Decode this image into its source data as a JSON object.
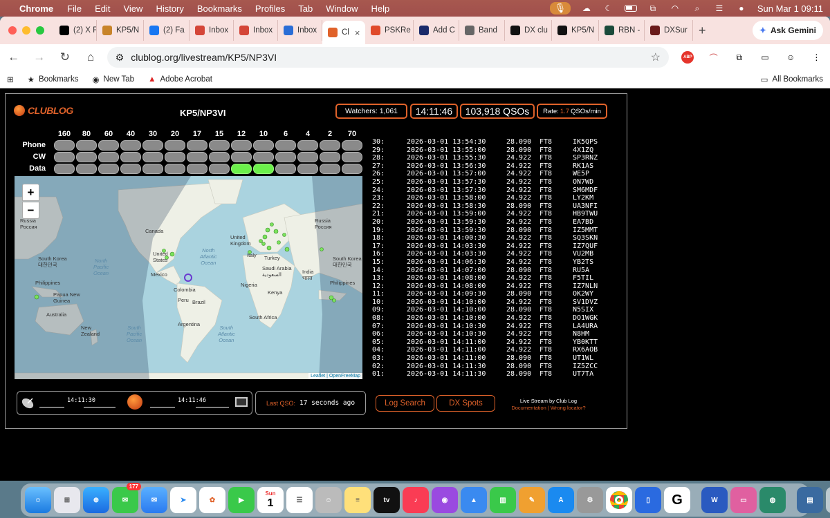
{
  "menubar": {
    "app": "Chrome",
    "items": [
      "File",
      "Edit",
      "View",
      "History",
      "Bookmarks",
      "Profiles",
      "Tab",
      "Window",
      "Help"
    ],
    "datetime": "Sun Mar 1  09:11"
  },
  "browser": {
    "tabs": [
      {
        "label": "(2) X F",
        "icon": "x-icon",
        "color": "#000000"
      },
      {
        "label": "KP5/N",
        "icon": "kp5-icon",
        "color": "#c8842a"
      },
      {
        "label": "(2) Fa",
        "icon": "facebook-icon",
        "color": "#1877f2"
      },
      {
        "label": "Inbox",
        "icon": "gmail-icon",
        "color": "#d44638"
      },
      {
        "label": "Inbox",
        "icon": "gmail-icon",
        "color": "#d44638"
      },
      {
        "label": "Inbox",
        "icon": "mail-icon",
        "color": "#2a6dd6"
      },
      {
        "label": "Cl",
        "icon": "clublog-icon",
        "color": "#e0622a",
        "active": true
      },
      {
        "label": "PSKRe",
        "icon": "pskreporter-icon",
        "color": "#e04a2a"
      },
      {
        "label": "Add C",
        "icon": "add-c-icon",
        "color": "#1a2a6a"
      },
      {
        "label": "Band",
        "icon": "band-icon",
        "color": "#666666"
      },
      {
        "label": "DX clu",
        "icon": "dx-icon",
        "color": "#111111"
      },
      {
        "label": "KP5/N",
        "icon": "dx-icon",
        "color": "#111111"
      },
      {
        "label": "RBN -",
        "icon": "rbn-icon",
        "color": "#1a4a3a"
      },
      {
        "label": "DXSur",
        "icon": "dxsummit-icon",
        "color": "#6a1a1a"
      }
    ],
    "gemini_label": "Ask Gemini",
    "url": "clublog.org/livestream/KP5/NP3VI",
    "bookmarks": [
      "Bookmarks",
      "New Tab",
      "Adobe Acrobat"
    ],
    "all_bookmarks": "All Bookmarks"
  },
  "livestream": {
    "logo_text": "CLUBLOG",
    "callsign": "KP5/NP3VI",
    "watchers": "Watchers: 1,061",
    "clock": "14:11:46",
    "qsos": "103,918 QSOs",
    "rate_prefix": "Rate:",
    "rate_value": "1.7",
    "rate_suffix": "QSOs/min",
    "bands": [
      "160",
      "80",
      "60",
      "40",
      "30",
      "20",
      "17",
      "15",
      "12",
      "10",
      "6",
      "4",
      "2",
      "70"
    ],
    "modes": [
      "Phone",
      "CW",
      "Data"
    ],
    "active": {
      "Data": [
        "12",
        "10"
      ]
    },
    "map_labels": {
      "russia": "Russia\nРоссия",
      "canada": "Canada",
      "us": "United\nStates",
      "mexico": "Mexico",
      "colombia": "Colombia",
      "peru": "Peru",
      "brazil": "Brazil",
      "argentina": "Argentina",
      "uk": "United\nKingdom",
      "turkey": "Turkey",
      "saudi": "Saudi Arabia\nالسعودية",
      "india": "India\nभारत",
      "nigeria": "Nigeria",
      "kenya": "Kenya",
      "south_africa": "South Africa",
      "south_korea": "South Korea\n대한민국",
      "philippines": "Philippines",
      "png": "Papua New\nGuinea",
      "australia": "Australia",
      "nz": "New\nZealand",
      "npo": "North\nPacific\nOcean",
      "nao": "North\nAtlantic\nOcean",
      "spo": "South\nPacific\nOcean",
      "sao": "South\nAtlantic\nOcean",
      "italy": "Italy"
    },
    "attribution_a": "Leaflet",
    "attribution_b": "OpenFreeMap",
    "qso_rows": [
      [
        "30:",
        "2026-03-01 13:54:30",
        "28.090",
        "FT8",
        "IK5QPS"
      ],
      [
        "29:",
        "2026-03-01 13:55:00",
        "28.090",
        "FT8",
        "4X1ZQ"
      ],
      [
        "28:",
        "2026-03-01 13:55:30",
        "24.922",
        "FT8",
        "SP3RNZ"
      ],
      [
        "27:",
        "2026-03-01 13:56:30",
        "24.922",
        "FT8",
        "RK1AS"
      ],
      [
        "26:",
        "2026-03-01 13:57:00",
        "24.922",
        "FT8",
        "WE5P"
      ],
      [
        "25:",
        "2026-03-01 13:57:30",
        "24.922",
        "FT8",
        "ON7WD"
      ],
      [
        "24:",
        "2026-03-01 13:57:30",
        "24.922",
        "FT8",
        "SM6MDF"
      ],
      [
        "23:",
        "2026-03-01 13:58:00",
        "24.922",
        "FT8",
        "LY2KM"
      ],
      [
        "22:",
        "2026-03-01 13:58:30",
        "28.090",
        "FT8",
        "UA3NFI"
      ],
      [
        "21:",
        "2026-03-01 13:59:00",
        "24.922",
        "FT8",
        "HB9TWU"
      ],
      [
        "20:",
        "2026-03-01 13:59:30",
        "24.922",
        "FT8",
        "EA7BD"
      ],
      [
        "19:",
        "2026-03-01 13:59:30",
        "28.090",
        "FT8",
        "IZ5MMT"
      ],
      [
        "18:",
        "2026-03-01 14:00:30",
        "24.922",
        "FT8",
        "SQ3SKN"
      ],
      [
        "17:",
        "2026-03-01 14:03:30",
        "24.922",
        "FT8",
        "IZ7QUF"
      ],
      [
        "16:",
        "2026-03-01 14:03:30",
        "24.922",
        "FT8",
        "VU2MB"
      ],
      [
        "15:",
        "2026-03-01 14:06:30",
        "24.922",
        "FT8",
        "YB2TS"
      ],
      [
        "14:",
        "2026-03-01 14:07:00",
        "28.090",
        "FT8",
        "RU5A"
      ],
      [
        "13:",
        "2026-03-01 14:08:00",
        "24.922",
        "FT8",
        "F5TIL"
      ],
      [
        "12:",
        "2026-03-01 14:08:00",
        "24.922",
        "FT8",
        "IZ7NLN"
      ],
      [
        "11:",
        "2026-03-01 14:09:30",
        "28.090",
        "FT8",
        "OK2WY"
      ],
      [
        "10:",
        "2026-03-01 14:10:00",
        "24.922",
        "FT8",
        "SV1DVZ"
      ],
      [
        "09:",
        "2026-03-01 14:10:00",
        "28.090",
        "FT8",
        "N5SIX"
      ],
      [
        "08:",
        "2026-03-01 14:10:00",
        "24.922",
        "FT8",
        "DO1WGK"
      ],
      [
        "07:",
        "2026-03-01 14:10:30",
        "24.922",
        "FT8",
        "LA4URA"
      ],
      [
        "06:",
        "2026-03-01 14:10:30",
        "24.922",
        "FT8",
        "N8HM"
      ],
      [
        "05:",
        "2026-03-01 14:11:00",
        "24.922",
        "FT8",
        "YB0KTT"
      ],
      [
        "04:",
        "2026-03-01 14:11:00",
        "24.922",
        "FT8",
        "RX6AOB"
      ],
      [
        "03:",
        "2026-03-01 14:11:00",
        "28.090",
        "FT8",
        "UT1WL"
      ],
      [
        "02:",
        "2026-03-01 14:11:30",
        "28.090",
        "FT8",
        "IZ5ZCC"
      ],
      [
        "01:",
        "2026-03-01 14:11:30",
        "28.090",
        "FT8",
        "UT7TA"
      ]
    ],
    "status_time_1": "14:11:30",
    "status_time_2": "14:11:46",
    "last_qso_label": "Last QSO:",
    "last_qso_value": "17 seconds ago",
    "log_search": "Log Search",
    "dx_spots": "DX Spots",
    "credit_line": "Live Stream by Club Log",
    "credit_links": "Documentation | Wrong locator?"
  },
  "dock": {
    "messages_badge": "177",
    "calendar_day": "1",
    "calendar_month": "Sun",
    "tv_label": "tv"
  },
  "colors": {
    "accent": "#e0622a",
    "active_band": "#6cf04b",
    "inactive_band": "#8a8a8a"
  }
}
